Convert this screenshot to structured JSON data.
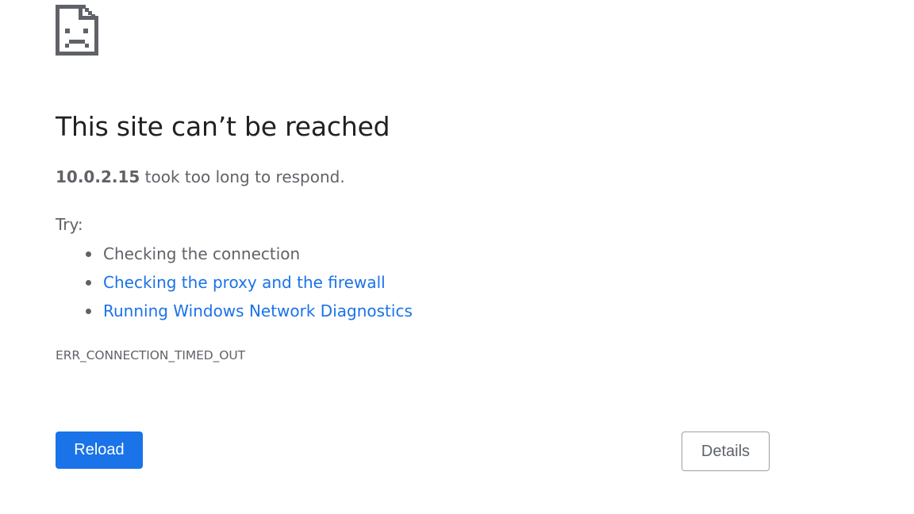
{
  "icon": {
    "name": "sad-page-icon",
    "color": "#5f6368"
  },
  "error": {
    "headline": "This site can’t be reached",
    "host": "10.0.2.15",
    "summary_suffix": " took too long to respond.",
    "try_label": "Try:",
    "suggestions": [
      {
        "label": "Checking the connection",
        "is_link": false
      },
      {
        "label": "Checking the proxy and the firewall",
        "is_link": true
      },
      {
        "label": "Running Windows Network Diagnostics",
        "is_link": true
      }
    ],
    "code": "ERR_CONNECTION_TIMED_OUT"
  },
  "buttons": {
    "reload_label": "Reload",
    "details_label": "Details"
  },
  "colors": {
    "primary": "#1a73e8",
    "text_secondary": "#5f6368",
    "headline": "#202124",
    "link": "#1a73e8"
  }
}
